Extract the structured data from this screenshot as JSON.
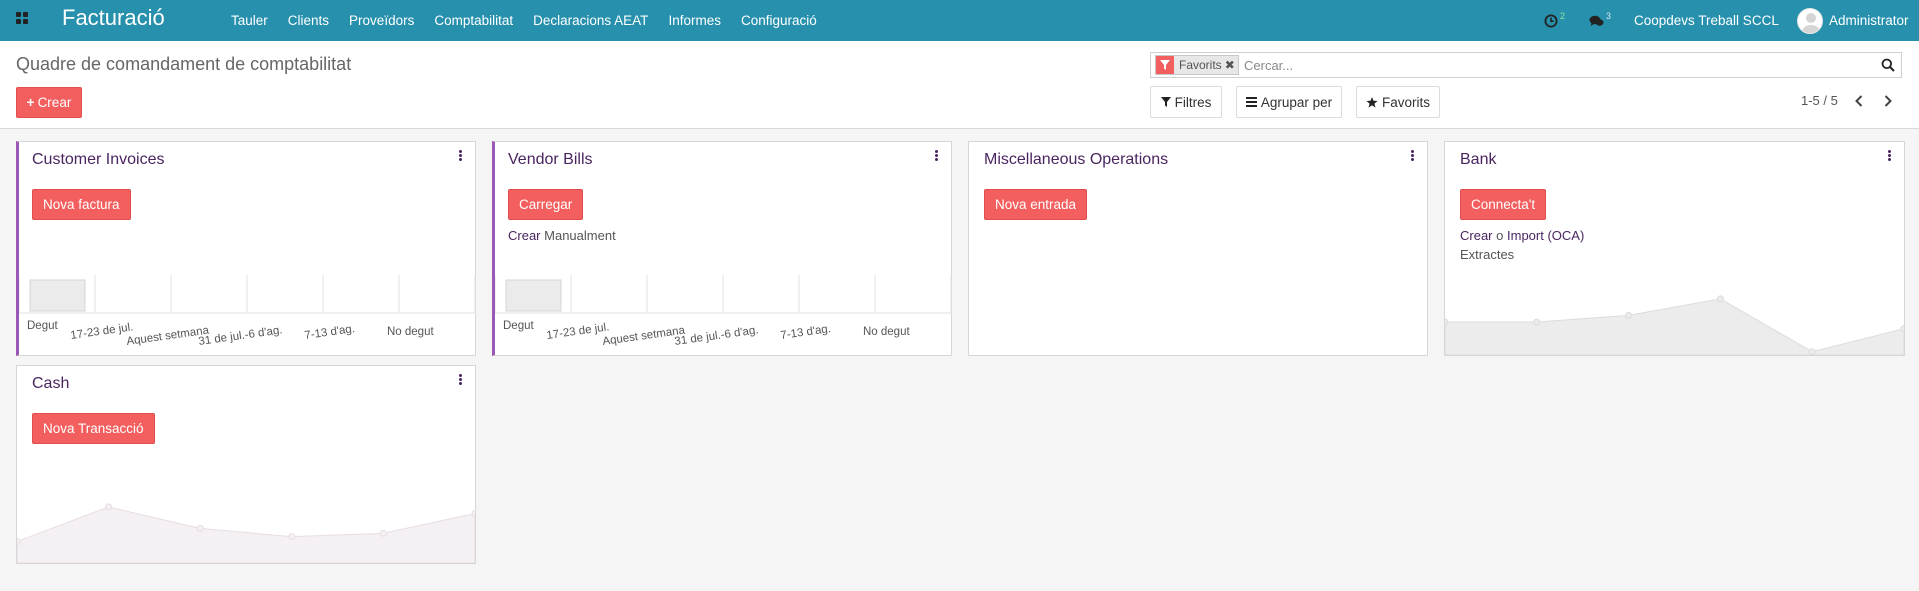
{
  "navbar": {
    "app_title": "Facturació",
    "menu": [
      "Tauler",
      "Clients",
      "Proveïdors",
      "Comptabilitat",
      "Declaracions AEAT",
      "Informes",
      "Configuració"
    ],
    "activity_count": "2",
    "messages_count": "3",
    "company": "Coopdevs Treball SCCL",
    "user": "Administrator",
    "bar_color": "#2690ad"
  },
  "control_panel": {
    "breadcrumb": "Quadre de comandament de comptabilitat",
    "create_label": "Crear",
    "search": {
      "facet_label": "Favorits",
      "placeholder": "Cercar..."
    },
    "filters_label": "Filtres",
    "groupby_label": "Agrupar per",
    "favorites_label": "Favorits",
    "pager": "1-5 / 5"
  },
  "colors": {
    "primary_button": "#f35e5e",
    "title": "#4a2560",
    "accent_border": "#9c58b5"
  },
  "journals": [
    {
      "title": "Customer Invoices",
      "button": "Nova factura",
      "chart_data": {
        "type": "bar",
        "categories": [
          "Degut",
          "17-23 de jul.",
          "Aquest setmana",
          "31 de jul.-6 d'ag.",
          "7-13 d'ag.",
          "No degut"
        ],
        "values": [
          1,
          0,
          0,
          0,
          0,
          0
        ],
        "note": "placeholder sample graph (no data)"
      }
    },
    {
      "title": "Vendor Bills",
      "button": "Carregar",
      "link_create": "Crear",
      "link_text": "Manualment",
      "chart_data": {
        "type": "bar",
        "categories": [
          "Degut",
          "17-23 de jul.",
          "Aquest setmana",
          "31 de jul.-6 d'ag.",
          "7-13 d'ag.",
          "No degut"
        ],
        "values": [
          1,
          0,
          0,
          0,
          0,
          0
        ],
        "note": "placeholder sample graph (no data)"
      }
    },
    {
      "title": "Miscellaneous Operations",
      "button": "Nova entrada"
    },
    {
      "title": "Bank",
      "button": "Connecta't",
      "link_create": "Crear",
      "link_or": "o",
      "link_import": "Import (OCA)",
      "link_statements": "Extractes",
      "chart_data": {
        "type": "area",
        "values": [
          1.0,
          1.0,
          1.4,
          2.4,
          -0.8,
          0.6
        ],
        "note": "placeholder sample graph (no data)"
      }
    },
    {
      "title": "Cash",
      "button": "Nova Transacció",
      "chart_data": {
        "type": "area",
        "values": [
          0.3,
          2.4,
          1.1,
          0.6,
          0.8,
          2.0
        ],
        "note": "placeholder sample graph (no data)"
      }
    }
  ]
}
